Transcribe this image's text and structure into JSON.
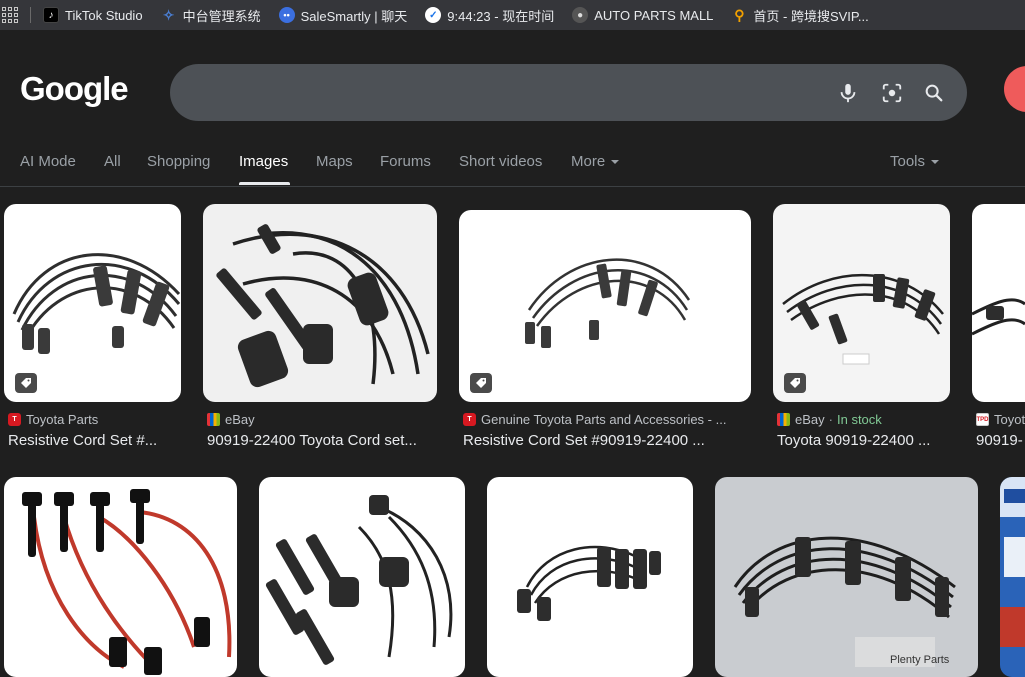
{
  "bookmarks": [
    {
      "label": "TikTok Studio",
      "icon": "tiktok-icon"
    },
    {
      "label": "中台管理系统",
      "icon": "zhongtai-icon"
    },
    {
      "label": "SaleSmartly | 聊天",
      "icon": "salesmartly-icon"
    },
    {
      "label": "9:44:23 - 现在时间",
      "icon": "clock-icon"
    },
    {
      "label": "AUTO PARTS MALL",
      "icon": "autoparts-icon"
    },
    {
      "label": "首页 - 跨境搜SVIP...",
      "icon": "search-orange-icon"
    }
  ],
  "header": {
    "logo": "Google",
    "search_value": "",
    "icons": [
      "microphone-icon",
      "lens-icon",
      "search-icon"
    ]
  },
  "tabs": [
    {
      "label": "AI Mode"
    },
    {
      "label": "All"
    },
    {
      "label": "Shopping"
    },
    {
      "label": "Images",
      "active": true
    },
    {
      "label": "Maps"
    },
    {
      "label": "Forums"
    },
    {
      "label": "Short videos"
    },
    {
      "label": "More"
    }
  ],
  "tools_label": "Tools",
  "results_row1": [
    {
      "source": "Toyota Parts",
      "title": "Resistive Cord Set #...",
      "stock": ""
    },
    {
      "source": "eBay",
      "title": "90919-22400 Toyota Cord set...",
      "stock": ""
    },
    {
      "source": "Genuine Toyota Parts and Accessories - ...",
      "title": "Resistive Cord Set #90919-22400 ...",
      "stock": ""
    },
    {
      "source": "eBay",
      "title": "Toyota 90919-22400 ...",
      "stock": "In stock"
    },
    {
      "source": "Toyot",
      "title": "90919-",
      "stock": ""
    }
  ],
  "watermarks": {
    "plenty": "Plenty Parts"
  },
  "colors": {
    "background": "#1f1f1f",
    "search_bg": "#4d5156",
    "in_stock": "#81c995",
    "cable_red": "#c0392b"
  }
}
